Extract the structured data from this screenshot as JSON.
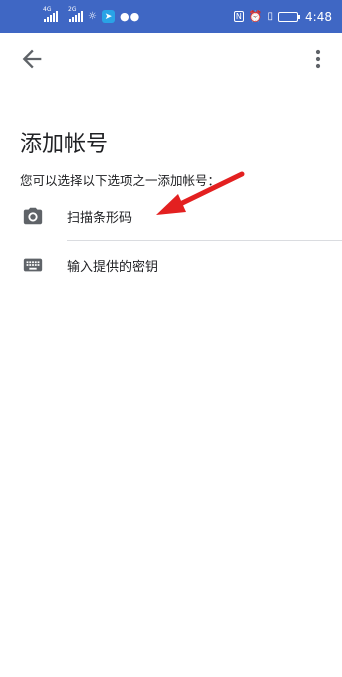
{
  "status_bar": {
    "network_1": "4G",
    "network_2": "2G",
    "time": "4:48",
    "battery_level": 0.8,
    "color": "#3f67c4"
  },
  "toolbar": {
    "back_icon": "arrow-back-icon",
    "more_icon": "more-vert-icon"
  },
  "page": {
    "title": "添加帐号",
    "subtitle": "您可以选择以下选项之一添加帐号："
  },
  "options": [
    {
      "icon": "camera-icon",
      "label": "扫描条形码"
    },
    {
      "icon": "keyboard-icon",
      "label": "输入提供的密钥"
    }
  ],
  "annotation": {
    "color": "#e32020"
  }
}
